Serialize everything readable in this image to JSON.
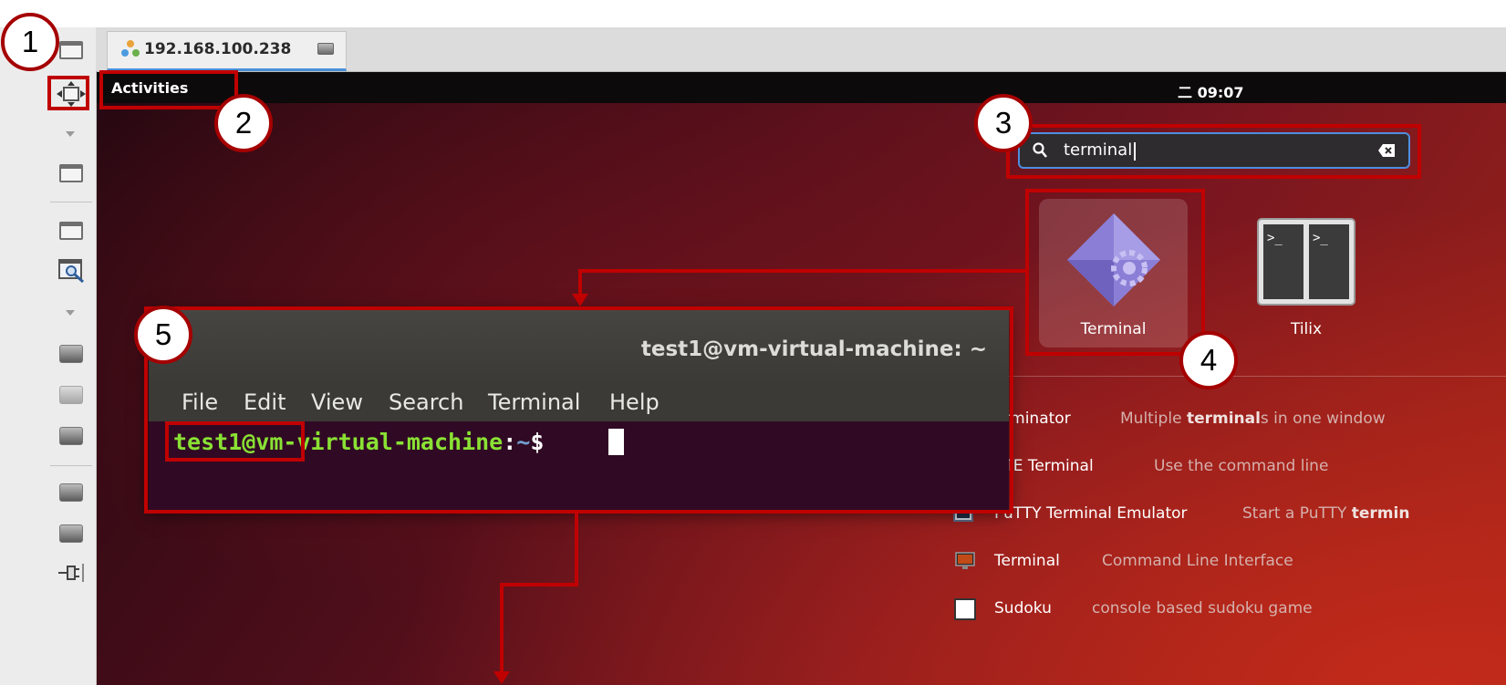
{
  "tab": {
    "title": "192.168.100.238"
  },
  "desktop": {
    "topbar": {
      "activities_label": "Activities",
      "clock": "09:07",
      "clock_glyph": "二"
    },
    "search": {
      "value": "terminal"
    },
    "app_grid": [
      {
        "label": "Terminal",
        "icon": "terminal-diamond-icon"
      },
      {
        "label": "Tilix",
        "icon": "tilix-icon"
      }
    ],
    "results": [
      {
        "name": "erminator",
        "desc_pre": "Multiple ",
        "desc_bold": "terminal",
        "desc_post": "s in one window",
        "icon": "terminator-icon"
      },
      {
        "name": "ATE Terminal",
        "desc_pre": "Use the command line",
        "desc_bold": "",
        "desc_post": "",
        "icon": "mate-terminal-icon"
      },
      {
        "name": "PuTTY Terminal Emulator",
        "desc_pre": "Start a PuTTY ",
        "desc_bold": "termin",
        "desc_post": "",
        "icon": "putty-icon"
      },
      {
        "name": "Terminal",
        "desc_pre": "Command Line Interface",
        "desc_bold": "",
        "desc_post": "",
        "icon": "terminal-monitor-icon"
      },
      {
        "name": "Sudoku",
        "desc_pre": "console based sudoku game",
        "desc_bold": "",
        "desc_post": "",
        "icon": "sudoku-icon"
      }
    ]
  },
  "terminal": {
    "title": "test1@vm-virtual-machine: ~",
    "menu": [
      "File",
      "Edit",
      "View",
      "Search",
      "Terminal",
      "Help"
    ],
    "prompt_user": "test1@vm-virtual-machine",
    "prompt_sep": ":",
    "prompt_path": "~",
    "prompt_symbol": "$"
  },
  "annotations": [
    "1",
    "2",
    "3",
    "4",
    "5"
  ],
  "colors": {
    "annotation_red": "#c00000",
    "prompt_green": "#8ae234",
    "prompt_blue": "#729fcf",
    "terminal_bg": "#300a24",
    "focus_blue": "#4e8ee0"
  }
}
